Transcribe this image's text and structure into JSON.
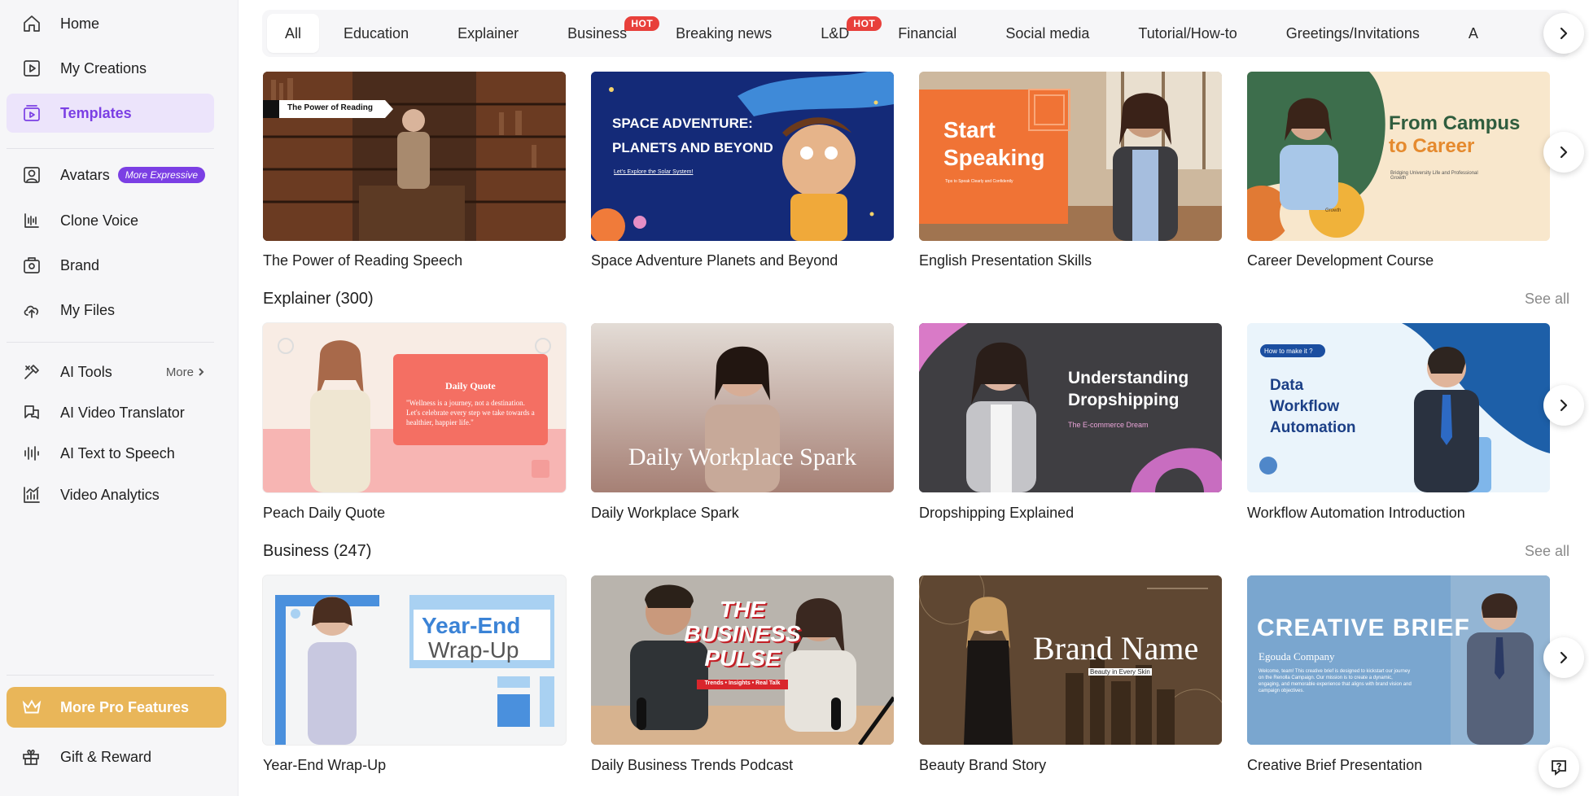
{
  "sidebar": {
    "items": [
      {
        "label": "Home",
        "icon": "home-icon"
      },
      {
        "label": "My Creations",
        "icon": "play-square-icon"
      },
      {
        "label": "Templates",
        "icon": "templates-icon",
        "active": true
      },
      {
        "label": "Avatars",
        "icon": "avatar-icon",
        "badge": "More Expressive"
      },
      {
        "label": "Clone Voice",
        "icon": "voice-wave-icon"
      },
      {
        "label": "Brand",
        "icon": "brand-icon"
      },
      {
        "label": "My Files",
        "icon": "cloud-upload-icon"
      },
      {
        "label": "AI Tools",
        "icon": "tools-icon",
        "more": "More"
      },
      {
        "label": "AI Video Translator",
        "icon": "translate-icon"
      },
      {
        "label": "AI Text to Speech",
        "icon": "audio-bars-icon"
      },
      {
        "label": "Video Analytics",
        "icon": "analytics-icon"
      }
    ],
    "pro_features": "More Pro Features",
    "gift": "Gift & Reward"
  },
  "tabs": [
    {
      "label": "All",
      "active": true
    },
    {
      "label": "Education"
    },
    {
      "label": "Explainer"
    },
    {
      "label": "Business",
      "hot": "HOT"
    },
    {
      "label": "Breaking news"
    },
    {
      "label": "L&D",
      "hot": "HOT"
    },
    {
      "label": "Financial"
    },
    {
      "label": "Social media"
    },
    {
      "label": "Tutorial/How-to"
    },
    {
      "label": "Greetings/Invitations"
    },
    {
      "label": "A"
    }
  ],
  "sections": [
    {
      "title": "",
      "see_all": "",
      "cards": [
        {
          "label": "The Power of Reading Speech",
          "thumb_text": [
            "The Power of Reading"
          ]
        },
        {
          "label": "Space Adventure Planets and Beyond",
          "thumb_text": [
            "SPACE ADVENTURE:",
            "PLANETS AND BEYOND",
            "Let's Explore the Solar System!"
          ]
        },
        {
          "label": "English Presentation Skills",
          "thumb_text": [
            "Start",
            "Speaking",
            "Tips to Speak Clearly and Confidently"
          ]
        },
        {
          "label": "Career Development Course",
          "thumb_text": [
            "From Campus",
            "to Career",
            "Bridging University Life and Professional Growth",
            "Growth"
          ]
        }
      ]
    },
    {
      "title": "Explainer (300)",
      "see_all": "See all",
      "cards": [
        {
          "label": "Peach Daily Quote",
          "thumb_text": [
            "Daily Quote",
            "\"Wellness is a journey, not a destination. Let's celebrate every step we take towards a healthier, happier life.\""
          ]
        },
        {
          "label": "Daily Workplace Spark",
          "thumb_text": [
            "Daily Workplace Spark"
          ]
        },
        {
          "label": "Dropshipping Explained",
          "thumb_text": [
            "Understanding",
            "Dropshipping",
            "The E-commerce Dream"
          ]
        },
        {
          "label": "Workflow Automation Introduction",
          "thumb_text": [
            "How to make it ?",
            "Data",
            "Workflow",
            "Automation"
          ]
        }
      ]
    },
    {
      "title": "Business (247)",
      "see_all": "See all",
      "cards": [
        {
          "label": "Year-End Wrap-Up",
          "thumb_text": [
            "Year-End",
            "Wrap-Up"
          ]
        },
        {
          "label": "Daily Business Trends Podcast",
          "thumb_text": [
            "THE",
            "BUSINESS",
            "PULSE",
            "Trends • Insights • Real Talk"
          ]
        },
        {
          "label": "Beauty Brand Story",
          "thumb_text": [
            "Brand Name",
            "Beauty in Every Skin"
          ]
        },
        {
          "label": "Creative Brief Presentation",
          "thumb_text": [
            "CREATIVE BRIEF",
            "Egouda Company",
            "Welcome, team! This creative brief is designed to kickstart our journey on the Renolla Campaign. Our mission is to create a dynamic, engaging, and memorable experience that aligns with brand vision and campaign objectives."
          ]
        }
      ]
    }
  ]
}
